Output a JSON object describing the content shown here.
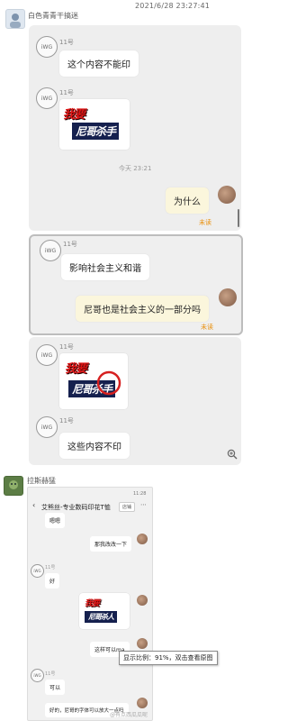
{
  "screenshot_timestamp": "2021/6/28 23:27:41",
  "posts": [
    {
      "username": "白色青青干搞迷"
    },
    {
      "username": "拉斯赫猛"
    }
  ],
  "chat1": {
    "messages": [
      {
        "sender": "11号",
        "avatar_text": "iWG",
        "text": "这个内容不能印"
      },
      {
        "sender": "11号",
        "avatar_text": "iWG",
        "sticker_top": "我要",
        "sticker_bottom": "尼哥杀手"
      },
      {
        "timeline": "今天 23:21"
      },
      {
        "own": true,
        "text": "为什么",
        "status": "未读"
      }
    ]
  },
  "chat2": {
    "messages": [
      {
        "sender": "11号",
        "avatar_text": "iWG",
        "text": "影响社会主义和谐"
      },
      {
        "own": true,
        "text": "尼哥也是社会主义的一部分吗",
        "status": "未读"
      }
    ]
  },
  "chat3": {
    "messages": [
      {
        "sender": "11号",
        "avatar_text": "iWG",
        "sticker_top": "我要",
        "sticker_bottom": "尼哥杀手"
      },
      {
        "sender": "11号",
        "avatar_text": "iWG",
        "text": "这些内容不印"
      }
    ]
  },
  "phone": {
    "status_time": "11:28",
    "title": "艾熊丝-专业数码印花T恤",
    "shop_button": "店铺",
    "msgs": [
      {
        "own": false,
        "text": "嗯嗯"
      },
      {
        "own": true,
        "text": "那我改改一下"
      },
      {
        "sender": "11号",
        "text": "好"
      },
      {
        "own": true,
        "sticker_top": "我要",
        "sticker_bottom": "尼哥杀人"
      },
      {
        "own": true,
        "text": "这样可以ma"
      },
      {
        "sender": "11号",
        "text": "可以"
      },
      {
        "own": false,
        "text": "好的，尼哥的字体可以放大一点吗"
      }
    ],
    "zoom_tooltip": "显示比例：91%，双击查看原图",
    "watermark": "@有点西瓜瓜呢"
  },
  "colors": {
    "panel_bg": "#eeeeee",
    "own_bubble": "#fbf6dc",
    "unread": "#e9910f",
    "sticker_red": "#e01515",
    "sticker_navy": "#15204e"
  }
}
